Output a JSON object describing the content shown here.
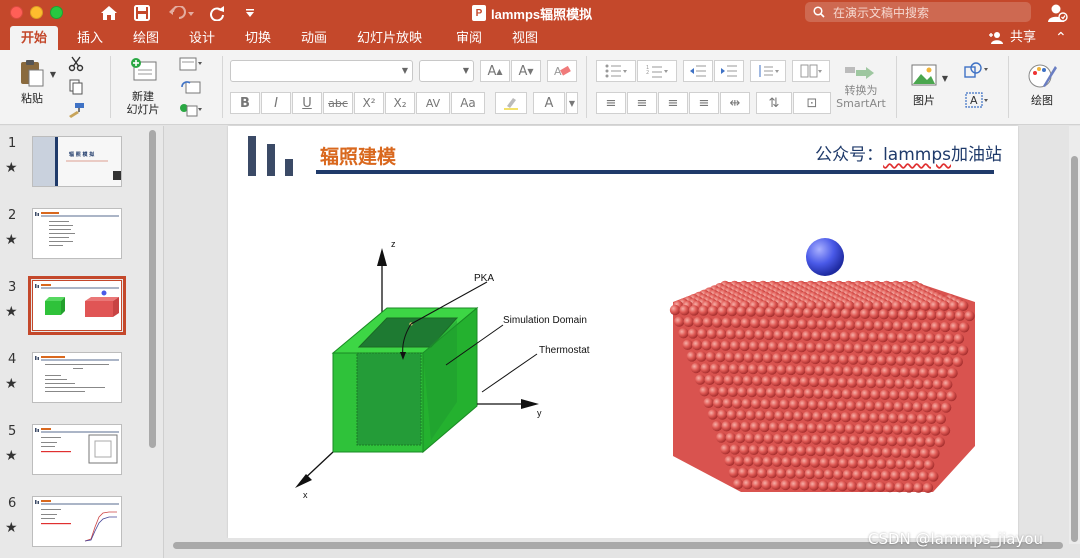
{
  "titlebar": {
    "doc_title": "lammps辐照模拟",
    "search_placeholder": "在演示文稿中搜索"
  },
  "ribbon_tabs": [
    "开始",
    "插入",
    "绘图",
    "设计",
    "切换",
    "动画",
    "幻灯片放映",
    "审阅",
    "视图"
  ],
  "share_label": "共享",
  "ribbon": {
    "paste_label": "粘贴",
    "new_slide_label_1": "新建",
    "new_slide_label_2": "幻灯片",
    "convert_label_1": "转换为",
    "convert_label_2": "SmartArt",
    "picture_label": "图片",
    "draw_label": "绘图",
    "format_buttons": [
      "B",
      "I",
      "U",
      "abc",
      "X²",
      "X₂",
      "AV",
      "Aa",
      "A"
    ]
  },
  "thumbnails": [
    {
      "num": "1",
      "star": "★",
      "text": "辐 照 模 拟"
    },
    {
      "num": "2",
      "star": "★",
      "text": ""
    },
    {
      "num": "3",
      "star": "★",
      "text": ""
    },
    {
      "num": "4",
      "star": "★",
      "text": ""
    },
    {
      "num": "5",
      "star": "★",
      "text": ""
    },
    {
      "num": "6",
      "star": "★",
      "text": ""
    }
  ],
  "slide": {
    "title": "辐照建模",
    "account_prefix": "公众号：",
    "account_name": "lammps",
    "account_suffix": "加油站",
    "figure_left": {
      "label_z": "z",
      "label_y": "y",
      "label_x": "x",
      "label_pka": "PKA",
      "label_domain": "Simulation Domain",
      "label_thermostat": "Thermostat"
    }
  },
  "watermark": "CSDN @lammps_jiayou",
  "colors": {
    "accent": "#c4482b",
    "title_orange": "#d9681e",
    "navy": "#1f3a6a",
    "cube_green": "#2fc23a",
    "atom_red": "#e05555",
    "ion_blue": "#4a5ae8"
  }
}
